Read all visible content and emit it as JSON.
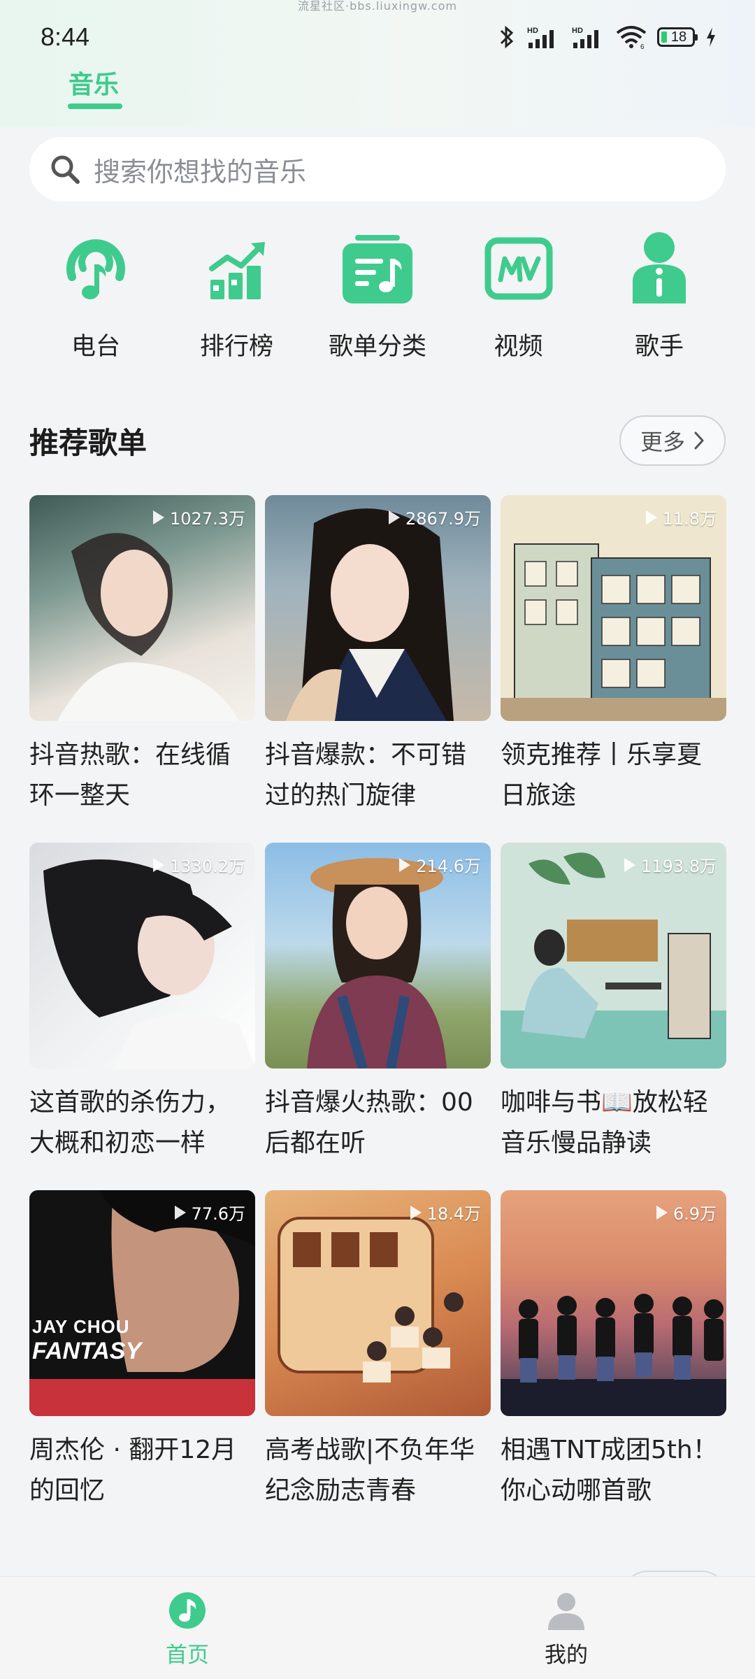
{
  "watermark": "流星社区·bbs.liuxingw.com",
  "status_bar": {
    "time": "8:44",
    "battery": "18",
    "icons": [
      "bluetooth-icon",
      "hd-signal-icon",
      "hd-signal-icon",
      "wifi-icon",
      "battery-icon",
      "charging-icon"
    ]
  },
  "top_tabs": [
    {
      "label": "音乐",
      "active": true
    }
  ],
  "search": {
    "placeholder": "搜索你想找的音乐"
  },
  "categories": [
    {
      "label": "电台",
      "icon": "radio-icon"
    },
    {
      "label": "排行榜",
      "icon": "chart-icon"
    },
    {
      "label": "歌单分类",
      "icon": "playlist-icon"
    },
    {
      "label": "视频",
      "icon": "mv-icon"
    },
    {
      "label": "歌手",
      "icon": "singer-icon"
    }
  ],
  "section": {
    "title": "推荐歌单",
    "more_label": "更多"
  },
  "playlists": [
    {
      "title": "抖音热歌：在线循环一整天",
      "plays": "1027.3万"
    },
    {
      "title": "抖音爆款：不可错过的热门旋律",
      "plays": "2867.9万"
    },
    {
      "title": "领克推荐丨乐享夏日旅途",
      "plays": "11.8万"
    },
    {
      "title": "这首歌的杀伤力，大概和初恋一样",
      "plays": "1330.2万"
    },
    {
      "title": "抖音爆火热歌：00后都在听",
      "plays": "214.6万"
    },
    {
      "title": "咖啡与书📖放松轻音乐慢品静读",
      "plays": "1193.8万"
    },
    {
      "title": "周杰伦 · 翻开12月的回忆",
      "plays": "77.6万",
      "cover_text": [
        "JAY CHOU",
        "FANTASY"
      ]
    },
    {
      "title": "高考战歌|不负年华纪念励志青春",
      "plays": "18.4万"
    },
    {
      "title": "相遇TNT成团5th！你心动哪首歌",
      "plays": "6.9万"
    }
  ],
  "bottom_nav": [
    {
      "label": "首页",
      "icon": "home-music-icon",
      "active": true
    },
    {
      "label": "我的",
      "icon": "profile-icon",
      "active": false
    }
  ],
  "colors": {
    "accent": "#3fcb8d",
    "background": "#f3f4f5"
  }
}
